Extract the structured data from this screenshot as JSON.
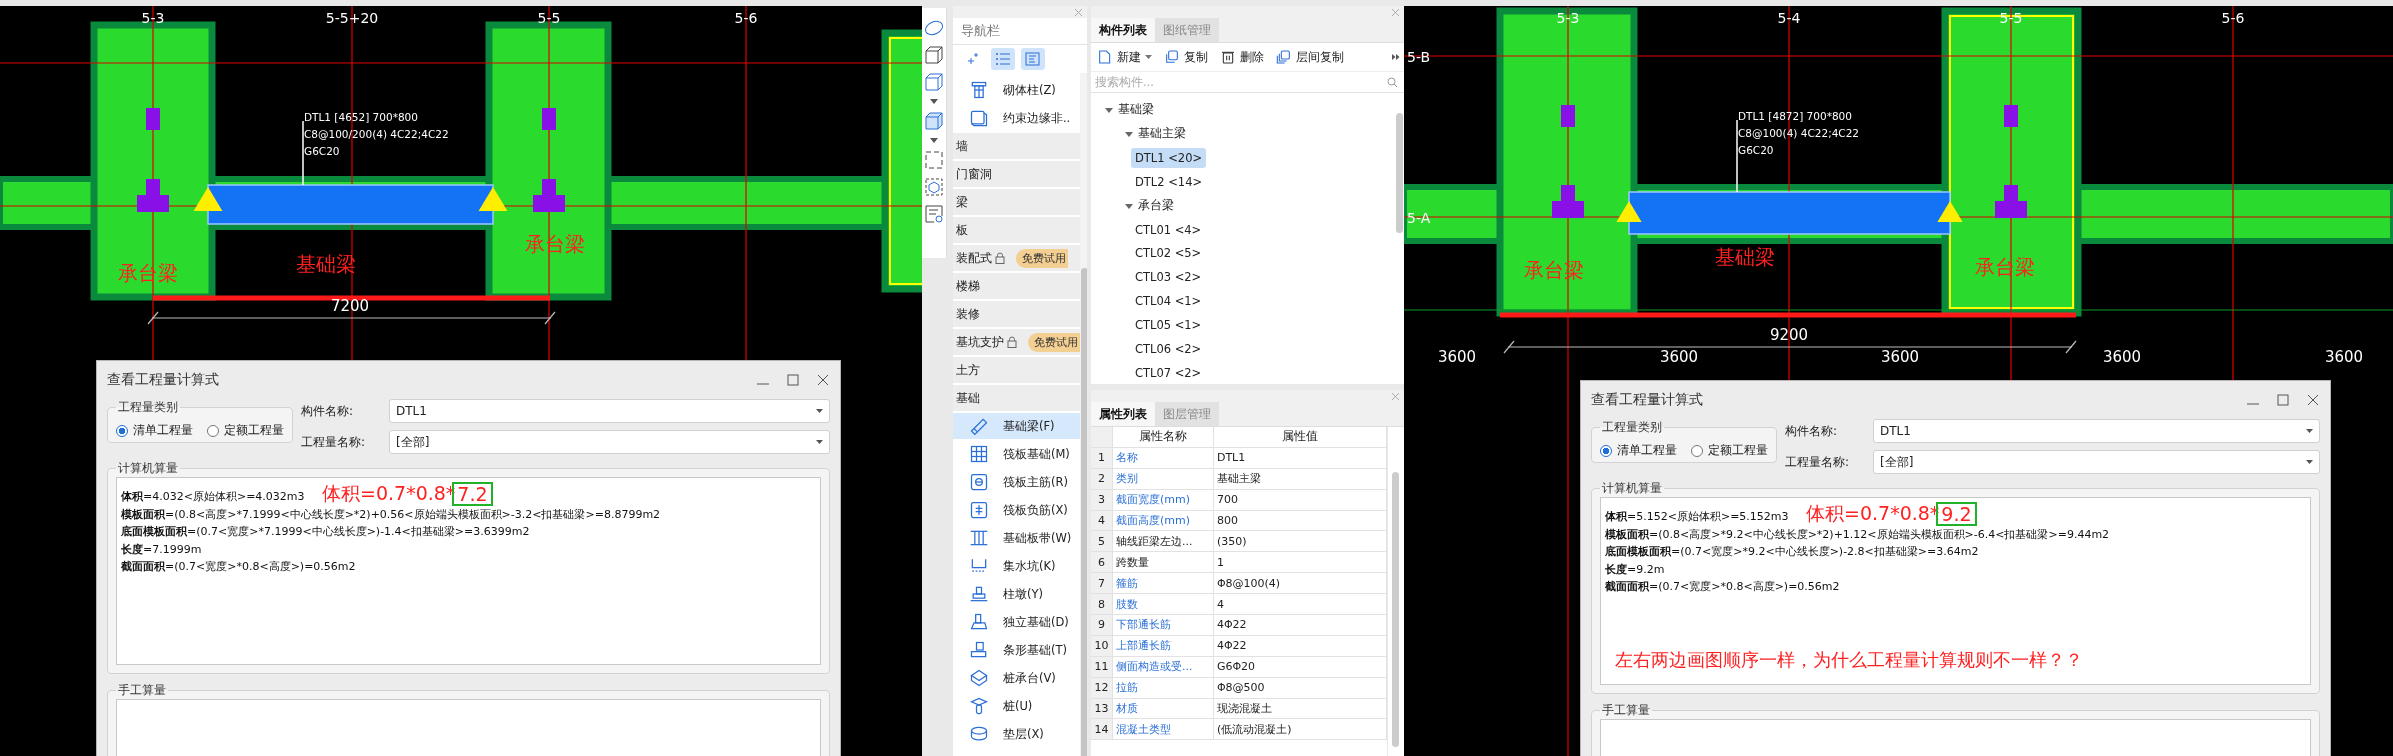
{
  "views": [
    {
      "axis_labels": [
        "5-3",
        "5-5+20",
        "5-5",
        "5-6"
      ],
      "beam_annotation": [
        "DTL1 [4652] 700*800",
        "C8@100/200(4) 4C22;4C22",
        "G6C20"
      ],
      "region_labels": [
        "承台梁",
        "基础梁",
        "承台梁"
      ],
      "dimension": "7200",
      "dialog": {
        "title": "查看工程量计算式",
        "type_group": {
          "label": "工程量类别",
          "options": [
            {
              "label": "清单工程量",
              "selected": true
            },
            {
              "label": "定额工程量",
              "selected": false
            }
          ]
        },
        "fields": [
          {
            "label": "构件名称:",
            "value": "DTL1"
          },
          {
            "label": "工程量名称:",
            "value": "[全部]"
          }
        ],
        "computed": {
          "label": "计算机算量",
          "lines": [
            "**体积**=4.032<原始体积>=4.032m3",
            "**模板面积**=(0.8<高度>*7.1999<中心线长度>*2)+0.56<原始端头模板面积>-3.2<扣基础梁>=8.8799m2",
            "**底面模板面积**=(0.7<宽度>*7.1999<中心线长度>)-1.4<扣基础梁>=3.6399m2",
            "**长度**=7.1999m",
            "**截面面积**=(0.7<宽度>*0.8<高度>)=0.56m2"
          ],
          "annotation": {
            "text": "体积=0.7*0.8*",
            "boxed": "7.2"
          }
        },
        "manual": {
          "label": "手工算量"
        }
      }
    },
    {
      "axis_labels": [
        "5-3",
        "5-4",
        "5-5",
        "5-6"
      ],
      "row_labels": [
        "5-B",
        "5-A"
      ],
      "beam_annotation": [
        "DTL1 [4872] 700*800",
        "C8@100(4) 4C22;4C22",
        "G6C20"
      ],
      "region_labels": [
        "承台梁",
        "基础梁",
        "承台梁"
      ],
      "dimension": "9200",
      "bottom_dimensions": [
        "3600",
        "3600",
        "3600",
        "3600",
        "3600"
      ],
      "dialog": {
        "title": "查看工程量计算式",
        "type_group": {
          "label": "工程量类别",
          "options": [
            {
              "label": "清单工程量",
              "selected": true
            },
            {
              "label": "定额工程量",
              "selected": false
            }
          ]
        },
        "fields": [
          {
            "label": "构件名称:",
            "value": "DTL1"
          },
          {
            "label": "工程量名称:",
            "value": "[全部]"
          }
        ],
        "computed": {
          "label": "计算机算量",
          "lines": [
            "**体积**=5.152<原始体积>=5.152m3",
            "**模板面积**=(0.8<高度>*9.2<中心线长度>*2)+1.12<原始端头模板面积>-6.4<扣基础梁>=9.44m2",
            "**底面模板面积**=(0.7<宽度>*9.2<中心线长度>)-2.8<扣基础梁>=3.64m2",
            "**长度**=9.2m",
            "**截面面积**=(0.7<宽度>*0.8<高度>)=0.56m2"
          ],
          "annotation": {
            "text": "体积=0.7*0.8*",
            "boxed": "9.2"
          },
          "note": "左右两边画图顺序一样，为什么工程量计算规则不一样？？"
        },
        "manual": {
          "label": "手工算量"
        }
      }
    }
  ],
  "nav": {
    "title": "导航栏",
    "view_buttons": [
      {
        "selected": false
      },
      {
        "selected": true
      },
      {
        "selected": true
      }
    ],
    "items": [
      {
        "kind": "item",
        "label": "砌体柱(Z)",
        "selected": false
      },
      {
        "kind": "item",
        "label": "约束边缘非..",
        "selected": false
      },
      {
        "kind": "category",
        "label": "墙",
        "locked": false
      },
      {
        "kind": "category",
        "label": "门窗洞",
        "locked": false
      },
      {
        "kind": "category",
        "label": "梁",
        "locked": false
      },
      {
        "kind": "category",
        "label": "板",
        "locked": false
      },
      {
        "kind": "category",
        "label": "装配式",
        "locked": true,
        "badge": "免费试用"
      },
      {
        "kind": "category",
        "label": "楼梯",
        "locked": false
      },
      {
        "kind": "category",
        "label": "装修",
        "locked": false
      },
      {
        "kind": "category",
        "label": "基坑支护",
        "locked": true,
        "badge": "免费试用"
      },
      {
        "kind": "category",
        "label": "土方",
        "locked": false
      },
      {
        "kind": "category",
        "label": "基础",
        "locked": false
      },
      {
        "kind": "item",
        "label": "基础梁(F)",
        "selected": true
      },
      {
        "kind": "item",
        "label": "筏板基础(M)",
        "selected": false
      },
      {
        "kind": "item",
        "label": "筏板主筋(R)",
        "selected": false
      },
      {
        "kind": "item",
        "label": "筏板负筋(X)",
        "selected": false
      },
      {
        "kind": "item",
        "label": "基础板带(W)",
        "selected": false
      },
      {
        "kind": "item",
        "label": "集水坑(K)",
        "selected": false
      },
      {
        "kind": "item",
        "label": "柱墩(Y)",
        "selected": false
      },
      {
        "kind": "item",
        "label": "独立基础(D)",
        "selected": false
      },
      {
        "kind": "item",
        "label": "条形基础(T)",
        "selected": false
      },
      {
        "kind": "item",
        "label": "桩承台(V)",
        "selected": false
      },
      {
        "kind": "item",
        "label": "桩(U)",
        "selected": false
      },
      {
        "kind": "item",
        "label": "垫层(X)",
        "selected": false
      }
    ]
  },
  "component_list": {
    "tabs": [
      {
        "label": "构件列表",
        "selected": true
      },
      {
        "label": "图纸管理",
        "selected": false
      }
    ],
    "toolbar": [
      {
        "label": "新建",
        "dropdown": true
      },
      {
        "label": "复制",
        "dropdown": false
      },
      {
        "label": "删除",
        "dropdown": false
      },
      {
        "label": "层间复制",
        "dropdown": false
      }
    ],
    "search": {
      "placeholder": "搜索构件..."
    },
    "tree": [
      {
        "label": "基础梁",
        "expanded": true,
        "children": [
          {
            "label": "基础主梁",
            "expanded": true,
            "children": [
              {
                "label": "DTL1 <20>",
                "selected": true
              },
              {
                "label": "DTL2 <14>",
                "selected": false
              }
            ]
          },
          {
            "label": "承台梁",
            "expanded": true,
            "children": [
              {
                "label": "CTL01 <4>",
                "selected": false
              },
              {
                "label": "CTL02 <5>",
                "selected": false
              },
              {
                "label": "CTL03 <2>",
                "selected": false
              },
              {
                "label": "CTL04 <1>",
                "selected": false
              },
              {
                "label": "CTL05 <1>",
                "selected": false
              },
              {
                "label": "CTL06 <2>",
                "selected": false
              },
              {
                "label": "CTL07 <2>",
                "selected": false
              }
            ]
          }
        ]
      }
    ]
  },
  "properties": {
    "tabs": [
      {
        "label": "属性列表",
        "selected": true
      },
      {
        "label": "图层管理",
        "selected": false
      }
    ],
    "columns": [
      "属性名称",
      "属性值"
    ],
    "rows": [
      {
        "index": "1",
        "name": "名称",
        "value": "DTL1",
        "public": true
      },
      {
        "index": "2",
        "name": "类别",
        "value": "基础主梁",
        "public": true
      },
      {
        "index": "3",
        "name": "截面宽度(mm)",
        "value": "700",
        "public": true
      },
      {
        "index": "4",
        "name": "截面高度(mm)",
        "value": "800",
        "public": true
      },
      {
        "index": "5",
        "name": "轴线距梁左边...",
        "value": "(350)",
        "public": false
      },
      {
        "index": "6",
        "name": "跨数量",
        "value": "1",
        "public": false
      },
      {
        "index": "7",
        "name": "箍筋",
        "value": "Φ8@100(4)",
        "public": true
      },
      {
        "index": "8",
        "name": "肢数",
        "value": "4",
        "public": true
      },
      {
        "index": "9",
        "name": "下部通长筋",
        "value": "4Φ22",
        "public": true
      },
      {
        "index": "10",
        "name": "上部通长筋",
        "value": "4Φ22",
        "public": true
      },
      {
        "index": "11",
        "name": "侧面构造或受...",
        "value": "G6Φ20",
        "public": true
      },
      {
        "index": "12",
        "name": "拉筋",
        "value": "Φ8@500",
        "public": true
      },
      {
        "index": "13",
        "name": "材质",
        "value": "现浇混凝土",
        "public": true
      },
      {
        "index": "14",
        "name": "混凝土类型",
        "value": "(低流动混凝土)",
        "public": true
      }
    ]
  }
}
